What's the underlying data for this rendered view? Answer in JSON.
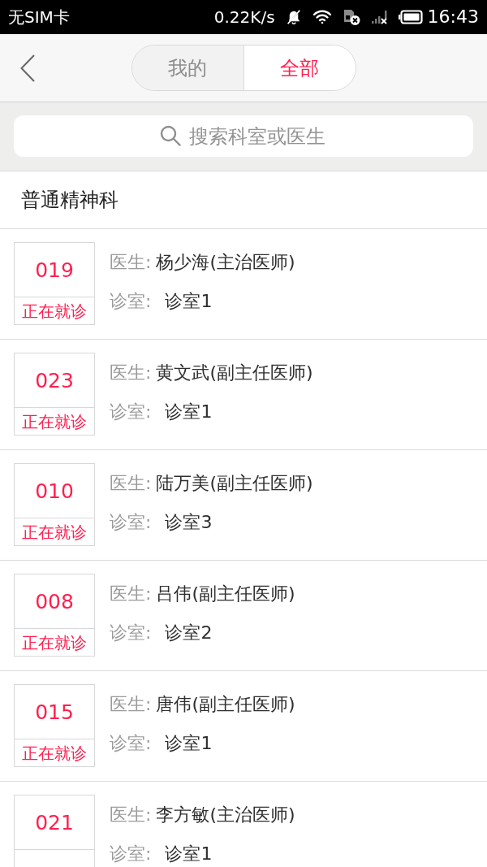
{
  "status_bar": {
    "carrier": "无SIM卡",
    "speed": "0.22K/s",
    "time": "16:43"
  },
  "header": {
    "tabs": [
      {
        "label": "我的",
        "selected": false
      },
      {
        "label": "全部",
        "selected": true
      }
    ]
  },
  "search": {
    "placeholder": "搜索科室或医生"
  },
  "section": {
    "title": "普通精神科"
  },
  "doctors": [
    {
      "number": "019",
      "status": "正在就诊",
      "doctor_label": "医生:",
      "doctor": "杨少海(主治医师)",
      "room_label": "诊室:",
      "room": "诊室1"
    },
    {
      "number": "023",
      "status": "正在就诊",
      "doctor_label": "医生:",
      "doctor": "黄文武(副主任医师)",
      "room_label": "诊室:",
      "room": "诊室1"
    },
    {
      "number": "010",
      "status": "正在就诊",
      "doctor_label": "医生:",
      "doctor": "陆万美(副主任医师)",
      "room_label": "诊室:",
      "room": "诊室3"
    },
    {
      "number": "008",
      "status": "正在就诊",
      "doctor_label": "医生:",
      "doctor": "吕伟(副主任医师)",
      "room_label": "诊室:",
      "room": "诊室2"
    },
    {
      "number": "015",
      "status": "正在就诊",
      "doctor_label": "医生:",
      "doctor": "唐伟(副主任医师)",
      "room_label": "诊室:",
      "room": "诊室1"
    },
    {
      "number": "021",
      "doctor_label": "医生:",
      "doctor": "李方敏(主治医师)",
      "room_label": "诊室:",
      "room": "诊室1"
    }
  ]
}
